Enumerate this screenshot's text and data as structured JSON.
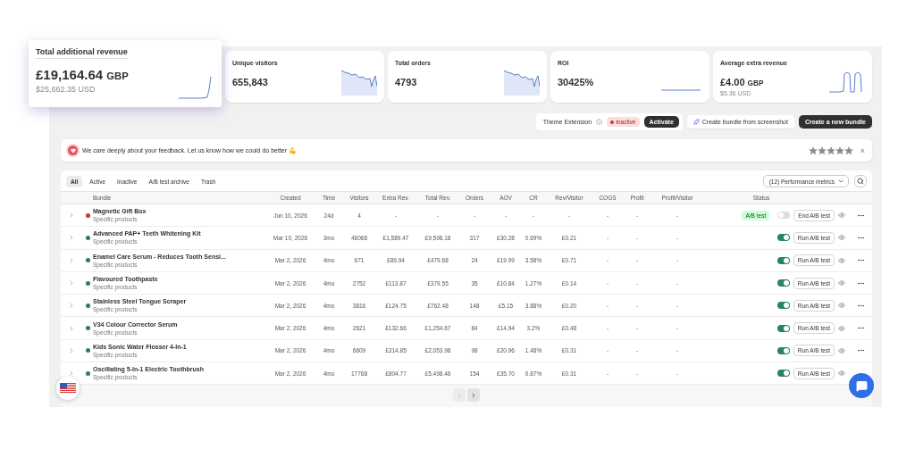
{
  "metrics": [
    {
      "title": "Total additional revenue",
      "value": "£19,164.64",
      "unit": "GBP",
      "subvalue": "$25,662.35 USD",
      "highlighted": true,
      "kind": "step"
    },
    {
      "title": "Unique visitors",
      "value": "655,843",
      "highlighted": false,
      "kind": "wavy"
    },
    {
      "title": "Total orders",
      "value": "4793",
      "highlighted": false,
      "kind": "wavy"
    },
    {
      "title": "ROI",
      "value": "30425%",
      "highlighted": false,
      "kind": "flat"
    },
    {
      "title": "Average extra revenue",
      "value": "£4.00",
      "unit": "GBP",
      "subvalue": "$5.36 USD",
      "highlighted": false,
      "kind": "pulses"
    }
  ],
  "theme_extension": {
    "label": "Theme Extension",
    "status": "Inactive",
    "action": "Activate"
  },
  "create_from_screenshot": "Create bundle from screenshot",
  "create_new": "Create a new bundle",
  "feedback": {
    "message": "We care deeply about your feedback. Let us know how we could do better 💪",
    "stars": 5,
    "close": "×"
  },
  "filter_tabs": [
    {
      "label": "All",
      "selected": true
    },
    {
      "label": "Active",
      "selected": false
    },
    {
      "label": "Inactive",
      "selected": false
    },
    {
      "label": "A/B test archive",
      "selected": false
    },
    {
      "label": "Trash",
      "selected": false
    }
  ],
  "metrics_dropdown": "(12) Performance metrics",
  "table": {
    "bundle_header": "Bundle",
    "columns": [
      "Created",
      "Time",
      "Visitors",
      "Extra Rev.",
      "Total Rev.",
      "Orders",
      "AOV",
      "CR",
      "Rev/Visitor",
      "COGS",
      "Profit",
      "Profit/Visitor",
      "Status"
    ],
    "rows": [
      {
        "name": "Magnetic Gift Box",
        "type": "Specific products",
        "color": "#c0392b",
        "cells": [
          "Jun 10, 2026",
          "24d",
          "4",
          "-",
          "-",
          "-",
          "-",
          "-",
          "-",
          "-",
          "-",
          "-"
        ],
        "badge": "A/B test",
        "on": false,
        "action": "End A/B test",
        "more_menu": true
      },
      {
        "name": "Advanced PAP+ Teeth Whitening Kit",
        "type": "Specific products",
        "color": "#2e7d4f",
        "cells": [
          "Mar 10, 2026",
          "3mo",
          "46068",
          "£1,589.47",
          "£9,598.18",
          "317",
          "£30.28",
          "0.69%",
          "£0.21",
          "-",
          "-",
          "-"
        ],
        "on": true,
        "action": "Run A/B test"
      },
      {
        "name": "Enamel Care Serum - Reduces Tooth Sensi...",
        "type": "Specific products",
        "color": "#2e7d4f",
        "cells": [
          "Mar 2, 2026",
          "4mo",
          "671",
          "£89.94",
          "£479.68",
          "24",
          "£19.99",
          "3.58%",
          "£0.71",
          "-",
          "-",
          "-"
        ],
        "on": true,
        "action": "Run A/B test"
      },
      {
        "name": "Flavoured Toothpaste",
        "type": "Specific products",
        "color": "#2e7d4f",
        "cells": [
          "Mar 2, 2026",
          "4mo",
          "2752",
          "£113.87",
          "£379.55",
          "35",
          "£10.84",
          "1.27%",
          "£0.14",
          "-",
          "-",
          "-"
        ],
        "on": true,
        "action": "Run A/B test"
      },
      {
        "name": "Stainless Steel Tongue Scraper",
        "type": "Specific products",
        "color": "#2e7d4f",
        "cells": [
          "Mar 2, 2026",
          "4mo",
          "3816",
          "£124.75",
          "£762.48",
          "148",
          "£5.15",
          "3.88%",
          "£0.20",
          "-",
          "-",
          "-"
        ],
        "on": true,
        "action": "Run A/B test"
      },
      {
        "name": "V34 Colour Corrector Serum",
        "type": "Specific products",
        "color": "#2e7d4f",
        "cells": [
          "Mar 2, 2026",
          "4mo",
          "2621",
          "£132.66",
          "£1,254.67",
          "84",
          "£14.94",
          "3.2%",
          "£0.48",
          "-",
          "-",
          "-"
        ],
        "on": true,
        "action": "Run A/B test"
      },
      {
        "name": "Kids Sonic Water Flosser 4-In-1",
        "type": "Specific products",
        "color": "#2e7d4f",
        "cells": [
          "Mar 2, 2026",
          "4mo",
          "6609",
          "£314.85",
          "£2,053.98",
          "98",
          "£20.96",
          "1.48%",
          "£0.31",
          "-",
          "-",
          "-"
        ],
        "on": true,
        "action": "Run A/B test"
      },
      {
        "name": "Oscillating 5-In-1 Electric Toothbrush",
        "type": "Specific products",
        "color": "#2e7d4f",
        "cells": [
          "Mar 2, 2026",
          "4mo",
          "17768",
          "£804.77",
          "£5,498.46",
          "154",
          "£35.70",
          "0.87%",
          "£0.31",
          "-",
          "-",
          "-"
        ],
        "on": true,
        "action": "Run A/B test",
        "more_menu": false
      }
    ]
  },
  "pagination": {
    "prev": {
      "disabled": true
    },
    "next": {
      "disabled": false
    }
  }
}
